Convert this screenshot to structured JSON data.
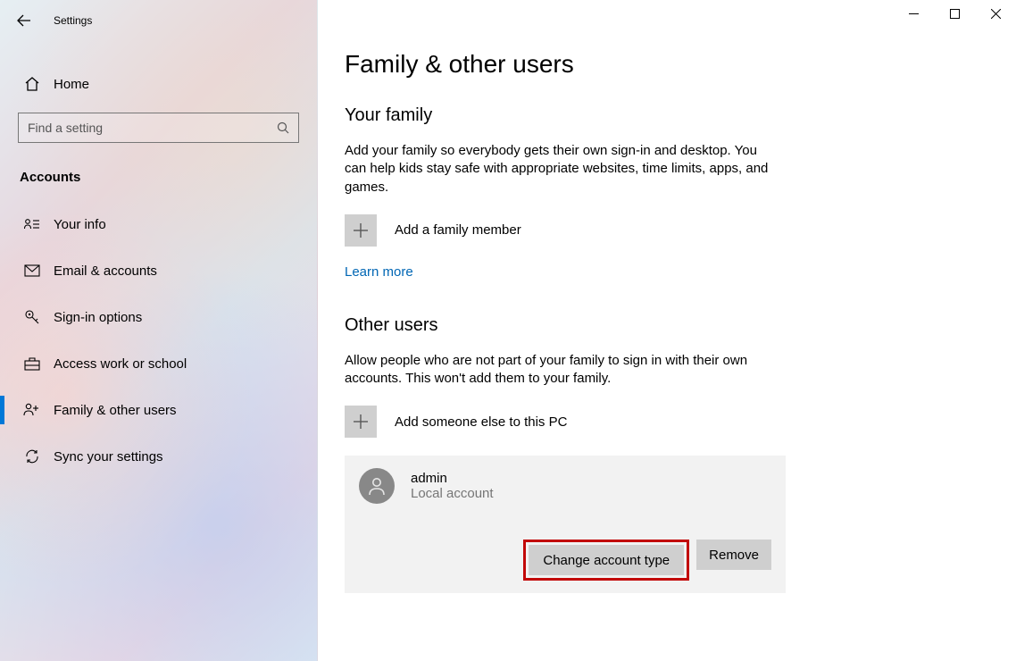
{
  "window": {
    "title": "Settings"
  },
  "sidebar": {
    "home": "Home",
    "search_placeholder": "Find a setting",
    "category": "Accounts",
    "items": [
      {
        "label": "Your info"
      },
      {
        "label": "Email & accounts"
      },
      {
        "label": "Sign-in options"
      },
      {
        "label": "Access work or school"
      },
      {
        "label": "Family & other users"
      },
      {
        "label": "Sync your settings"
      }
    ]
  },
  "page": {
    "title": "Family & other users",
    "family": {
      "heading": "Your family",
      "desc": "Add your family so everybody gets their own sign-in and desktop. You can help kids stay safe with appropriate websites, time limits, apps, and games.",
      "add_label": "Add a family member",
      "learn_more": "Learn more"
    },
    "other": {
      "heading": "Other users",
      "desc": "Allow people who are not part of your family to sign in with their own accounts. This won't add them to your family.",
      "add_label": "Add someone else to this PC"
    },
    "user": {
      "name": "admin",
      "type": "Local account",
      "change_btn": "Change account type",
      "remove_btn": "Remove"
    }
  }
}
